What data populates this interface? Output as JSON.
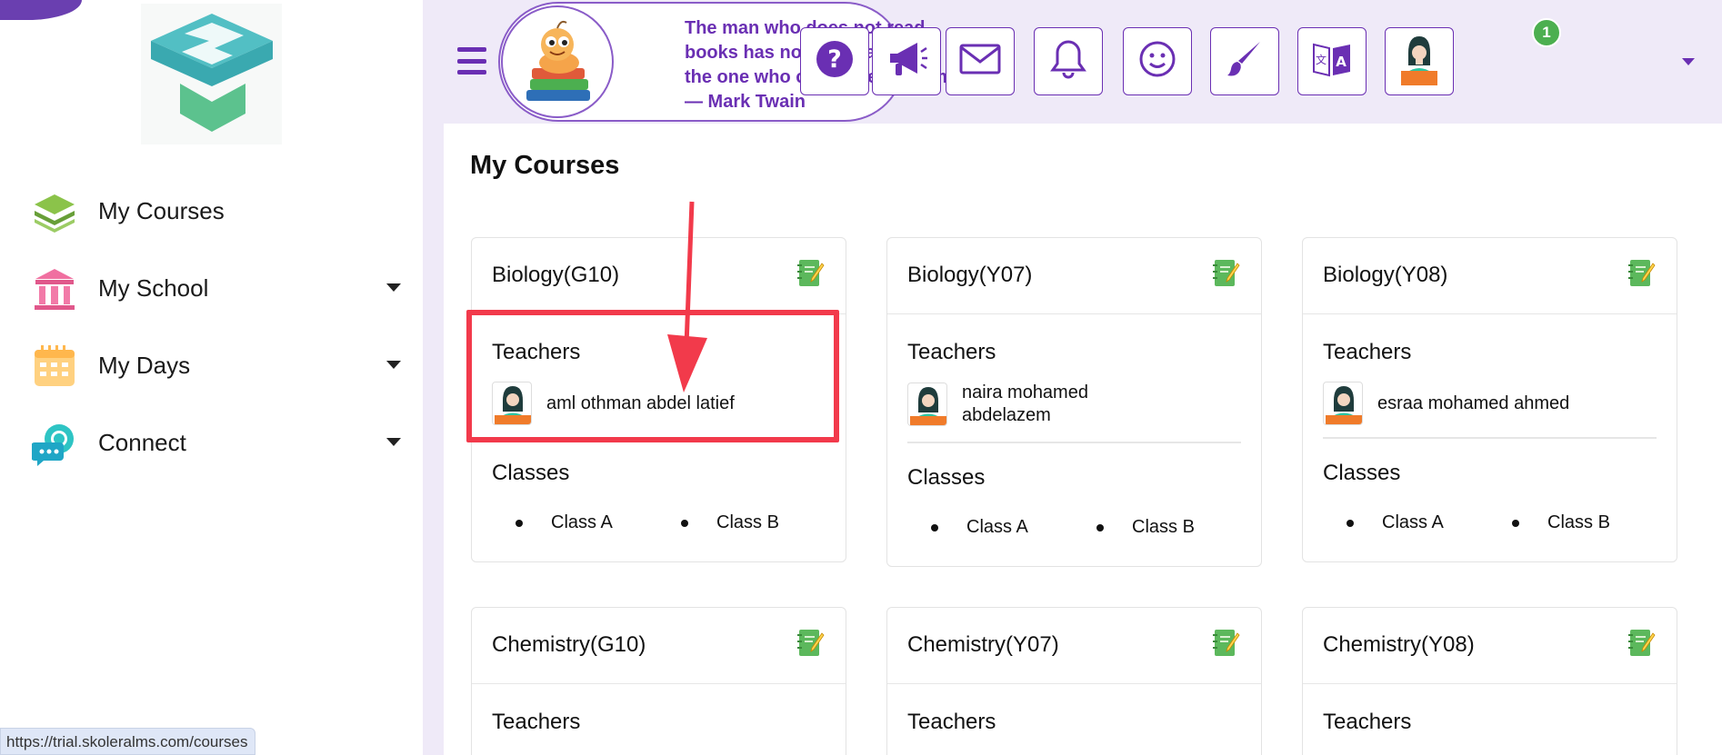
{
  "sidebar": {
    "items": [
      {
        "label": "My Courses",
        "icon": "layers-icon"
      },
      {
        "label": "My School",
        "icon": "school-building-icon"
      },
      {
        "label": "My Days",
        "icon": "calendar-icon"
      },
      {
        "label": "Connect",
        "icon": "chat-bubbles-icon"
      }
    ]
  },
  "header": {
    "quote": "The man who does not read books has no advantage over the one who cannot read them. — Mark Twain",
    "notification_count": "1",
    "buttons": [
      "help-icon",
      "megaphone-icon",
      "mail-icon",
      "bell-icon",
      "smiley-icon",
      "paintbrush-icon",
      "translate-icon",
      "profile-avatar"
    ]
  },
  "page": {
    "title": "My Courses"
  },
  "labels": {
    "teachers": "Teachers",
    "classes": "Classes"
  },
  "courses": [
    {
      "title": "Biology(G10)",
      "teachers": [
        "aml othman abdel latief"
      ],
      "classes": [
        "Class A",
        "Class B"
      ]
    },
    {
      "title": "Biology(Y07)",
      "teachers": [
        "naira mohamed\nabdelazem"
      ],
      "classes": [
        "Class A",
        "Class B"
      ]
    },
    {
      "title": "Biology(Y08)",
      "teachers": [
        "esraa mohamed ahmed"
      ],
      "classes": [
        "Class A",
        "Class B"
      ]
    },
    {
      "title": "Chemistry(G10)"
    },
    {
      "title": "Chemistry(Y07)"
    },
    {
      "title": "Chemistry(Y08)"
    }
  ],
  "status_bar": {
    "url": "https://trial.skoleralms.com/courses"
  },
  "colors": {
    "accent": "#6a2fb3",
    "background": "#efeaf8",
    "highlight": "#f23a4b",
    "badge": "#4caf50"
  }
}
